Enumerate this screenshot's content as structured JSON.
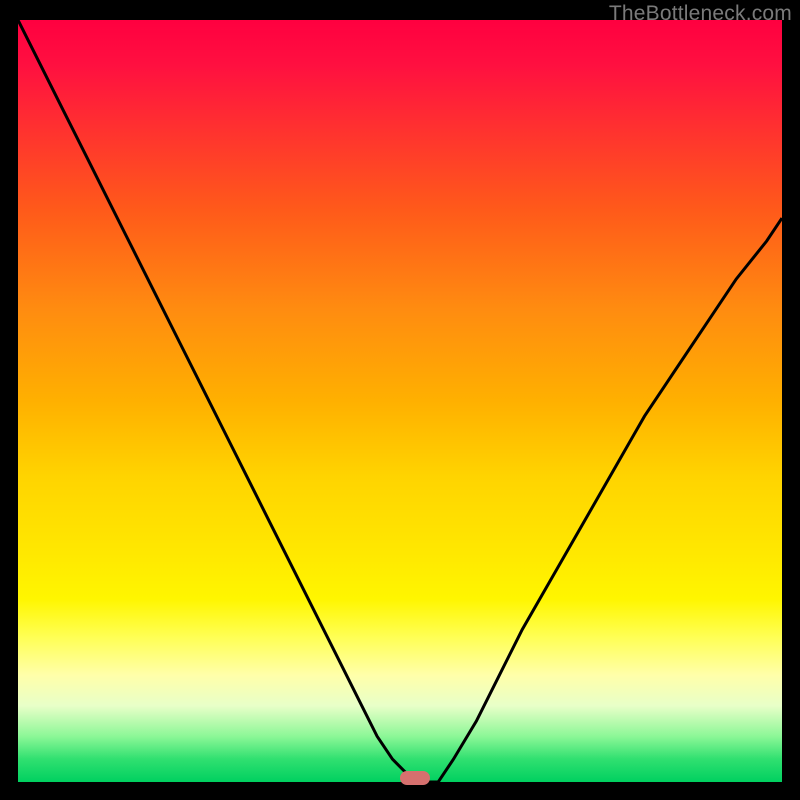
{
  "watermark": "TheBottleneck.com",
  "colors": {
    "bg": "#000000",
    "curve": "#000000",
    "marker": "#d6706e",
    "gradient_top": "#ff0040",
    "gradient_bottom": "#00d060"
  },
  "chart_data": {
    "type": "line",
    "title": "",
    "xlabel": "",
    "ylabel": "",
    "xlim": [
      0,
      100
    ],
    "ylim": [
      0,
      100
    ],
    "x": [
      0,
      3,
      6,
      9,
      12,
      15,
      18,
      21,
      24,
      27,
      30,
      33,
      36,
      39,
      42,
      45,
      47,
      49,
      51,
      53,
      55,
      57,
      60,
      63,
      66,
      70,
      74,
      78,
      82,
      86,
      90,
      94,
      98,
      100
    ],
    "y": [
      100,
      94,
      88,
      82,
      76,
      70,
      64,
      58,
      52,
      46,
      40,
      34,
      28,
      22,
      16,
      10,
      6,
      3,
      1,
      0,
      0,
      3,
      8,
      14,
      20,
      27,
      34,
      41,
      48,
      54,
      60,
      66,
      71,
      74
    ],
    "annotations": [
      {
        "type": "marker",
        "x": 52,
        "y": 0,
        "shape": "pill",
        "color": "#d6706e"
      }
    ]
  }
}
